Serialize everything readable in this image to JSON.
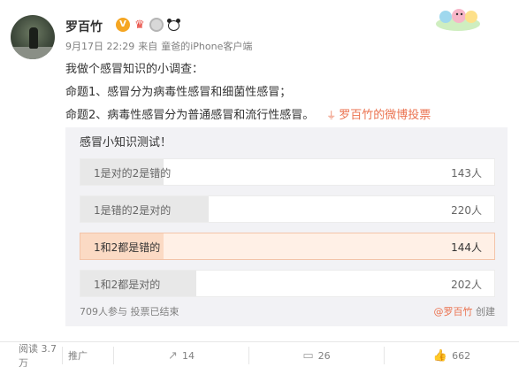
{
  "author": {
    "name": "罗百竹",
    "badges": [
      "verified-v-icon",
      "crown-icon",
      "medal-icon",
      "panda-icon"
    ]
  },
  "meta": {
    "date": "9月17日 22:29",
    "from": "来自",
    "device": "童爸的iPhone客户端"
  },
  "post": {
    "line1": "我做个感冒知识的小调查：",
    "line2": "命题1、感冒分为病毒性感冒和细菌性感冒；",
    "line3": "命题2、病毒性感冒分为普通感冒和流行性感冒。",
    "vote_link": "罗百竹的微博投票"
  },
  "poll": {
    "title": "感冒小知识测试！",
    "options": [
      {
        "label": "1是对的2是错的",
        "count": "143人",
        "fraction": 0.2
      },
      {
        "label": "1是错的2是对的",
        "count": "220人",
        "fraction": 0.31
      },
      {
        "label": "1和2都是错的",
        "count": "144人",
        "fraction": 0.2,
        "selected": true
      },
      {
        "label": "1和2都是对的",
        "count": "202人",
        "fraction": 0.28
      }
    ],
    "footer": "709人参与  投票已结束",
    "creator": "@罗百竹",
    "creator_suffix": "创建"
  },
  "actions": {
    "reads": "阅读 3.7万",
    "promote": "推广",
    "shares": "14",
    "comments": "26",
    "likes": "662"
  },
  "colors": {
    "accent": "#eb7350",
    "poll_bg": "#f2f2f5",
    "selected_fill": "#fbdac4"
  }
}
